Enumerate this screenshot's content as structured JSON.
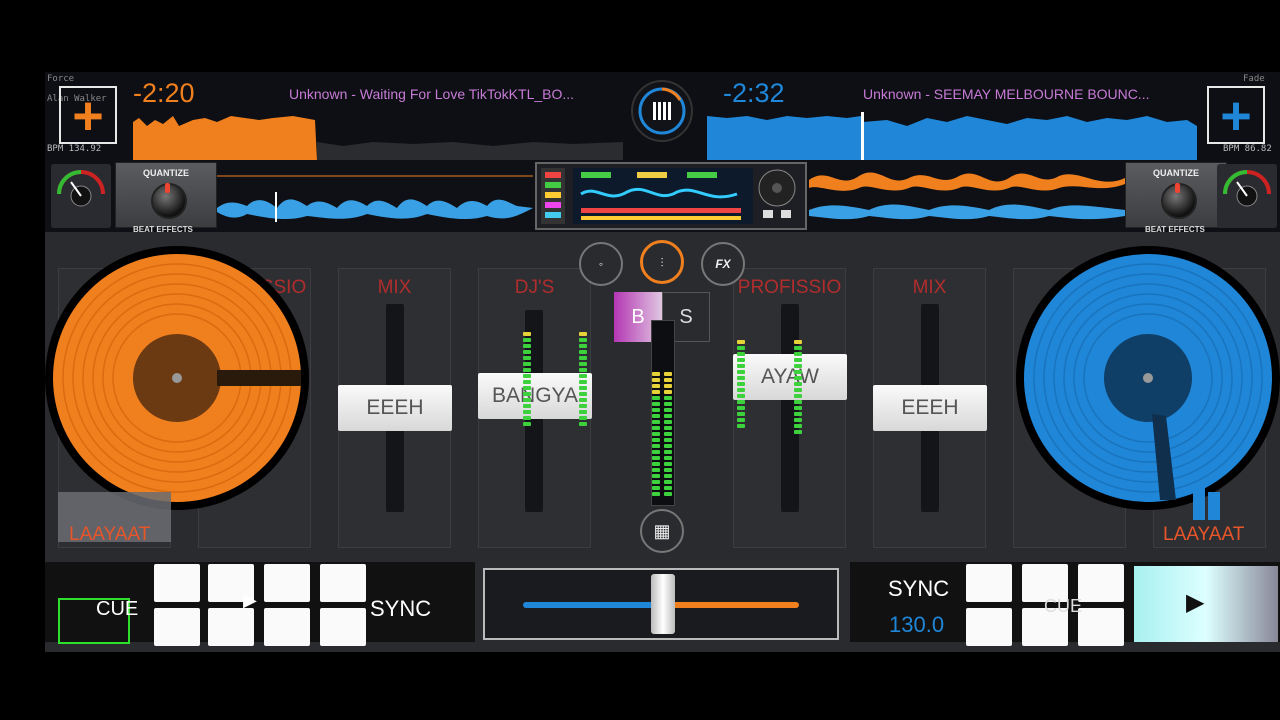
{
  "deck_a": {
    "color": "#f07f1e",
    "time_remaining": "-2:20",
    "track_title": "Unknown  -  Waiting For Love TikTokKTL_BO...",
    "artist_top": "Force",
    "artist": "Alan Walker",
    "bpm_readout": "BPM 134.92",
    "quantize_label": "QUANTIZE",
    "beat_effects_label": "BEAT EFFECTS",
    "add_icon": "plus-icon",
    "strip_labels": [
      "PROFISSIO",
      "MIX",
      "DJ'S"
    ],
    "fader_labels": [
      "EEEH",
      "BANGYA"
    ],
    "loop_label": "LAAYAAT",
    "cue_label": "CUE",
    "sync_label": "SYNC",
    "play_icon": "play-icon"
  },
  "deck_b": {
    "color": "#1f86d8",
    "time_remaining": "-2:32",
    "track_title": "Unknown  -  SEEMAY MELBOURNE BOUNC...",
    "artist_top": "Fade",
    "bpm_readout": "BPM 86.82",
    "quantize_label": "QUANTIZE",
    "beat_effects_label": "BEAT EFFECTS",
    "add_icon": "plus-icon",
    "strip_labels": [
      "PROFISSIO",
      "MIX"
    ],
    "fader_labels": [
      "AYAW",
      "EEEH"
    ],
    "loop_label": "LAAYAAT",
    "sync_label": "SYNC",
    "bpm": "130.0",
    "cue_label": "CUE",
    "play_icon": "play-icon"
  },
  "center": {
    "menu_icon": "menu-bars-icon",
    "reset_icon": "reset-icon",
    "eq_icon": "equalizer-icon",
    "fx_label": "FX",
    "b_label": "B",
    "s_label": "S",
    "grid_icon": "grid-icon"
  },
  "crossfader": {
    "position": 0.5
  }
}
